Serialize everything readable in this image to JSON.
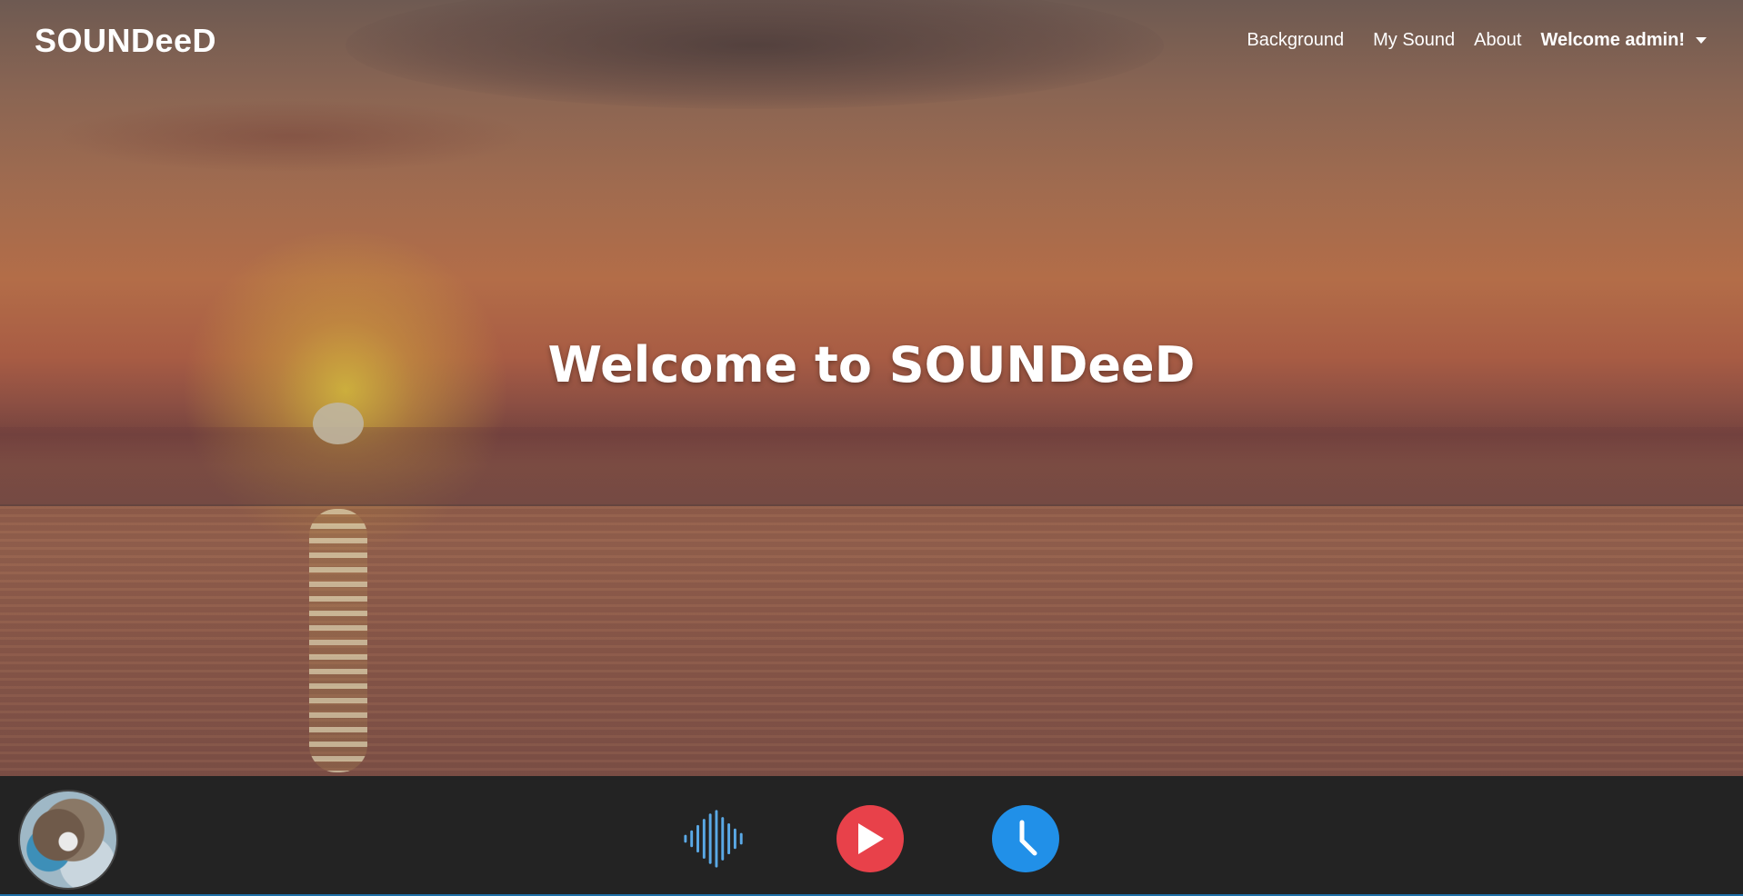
{
  "brand": "SOUNDeeD",
  "nav": {
    "items": [
      {
        "label": "Background"
      },
      {
        "label": "My Sound"
      },
      {
        "label": "About"
      }
    ],
    "user_menu_label": "Welcome admin!"
  },
  "hero": {
    "title": "Welcome to SOUNDeeD"
  },
  "player": {
    "controls": [
      {
        "icon": "soundwave-icon",
        "color": "#5aa9e6"
      },
      {
        "icon": "play-icon",
        "color": "#e8414a"
      },
      {
        "icon": "clock-icon",
        "color": "#2190e8"
      }
    ]
  }
}
